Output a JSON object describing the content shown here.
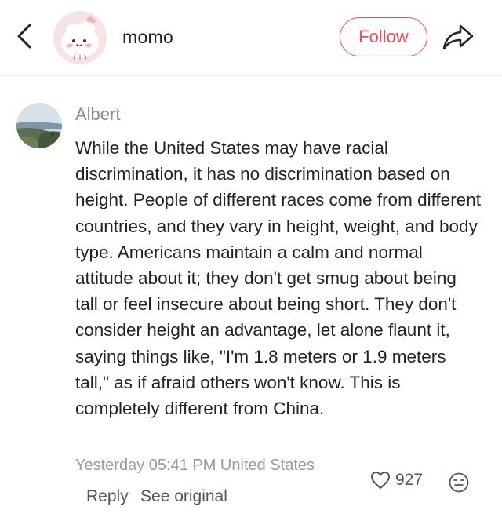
{
  "header": {
    "username": "momo",
    "follow_label": "Follow"
  },
  "comment": {
    "author": "Albert",
    "text": "While the United States may have racial discrimination, it has no discrimination based on height. People of different races come from different countries, and they vary in height, weight, and body type. Americans maintain a calm and normal attitude about it; they don't get smug about being tall or feel insecure about being short. They don't consider height an advantage, let alone flaunt it, saying things like, \"I'm 1.8 meters or 1.9 meters tall,\" as if afraid others won't know. This is completely different from China.",
    "meta": "Yesterday 05:41 PM United States",
    "like_count": "927",
    "reply_label": "Reply",
    "see_original_label": "See original"
  },
  "colors": {
    "accent": "#e8505b",
    "muted_text": "#8a8a8a",
    "body_text": "#222222"
  },
  "icons": {
    "back": "chevron-left-icon",
    "share": "share-arrow-icon",
    "like": "heart-outline-icon",
    "emoji": "emoji-face-icon"
  }
}
